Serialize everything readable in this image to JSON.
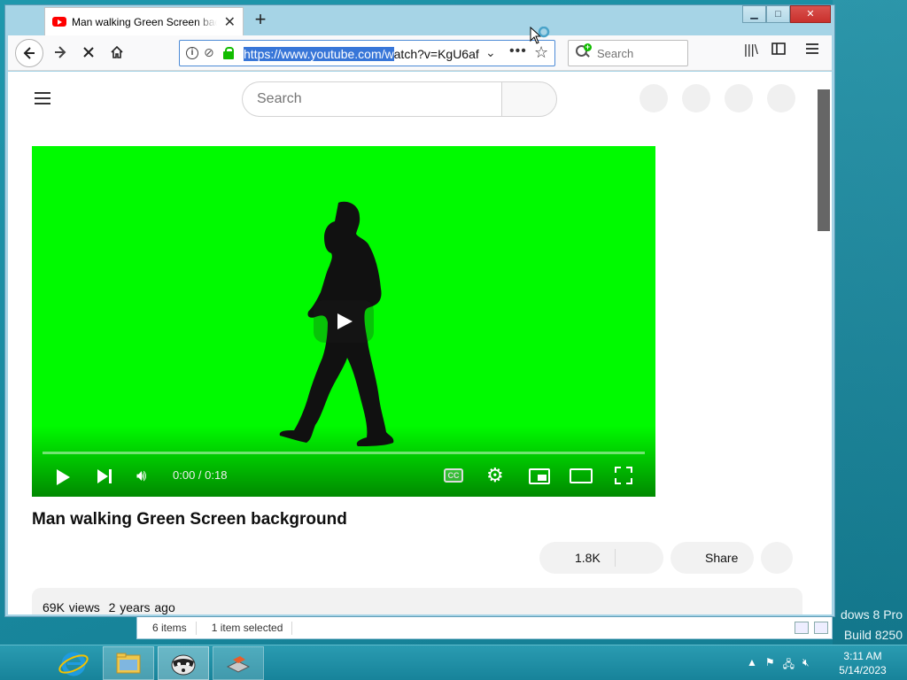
{
  "browser": {
    "tab_title": "Man walking Green Screen background",
    "tab_close": "✕",
    "new_tab": "+",
    "url_selected": "https://www.youtube.com/w",
    "url_rest": "atch?v=KgU6af",
    "search_placeholder": "Search",
    "window_buttons": {
      "minimize": "▁",
      "maximize": "□",
      "close": "✕"
    }
  },
  "youtube": {
    "search_placeholder": "Search",
    "video_title": "Man walking Green Screen background",
    "time_display": "0:00 / 0:18",
    "cc_label": "CC",
    "likes": "1.8K",
    "share_label": "Share",
    "views": "69K views",
    "uploaded": "2 years ago",
    "player_color": "#00fa00"
  },
  "explorer_status": {
    "items": "6 items",
    "selected": "1 item selected"
  },
  "desktop": {
    "watermark_line1": "dows 8 Pro",
    "watermark_line2": "Build 8250"
  },
  "taskbar": {
    "time": "3:11 AM",
    "date": "5/14/2023",
    "accent": "#1a8aa0"
  }
}
